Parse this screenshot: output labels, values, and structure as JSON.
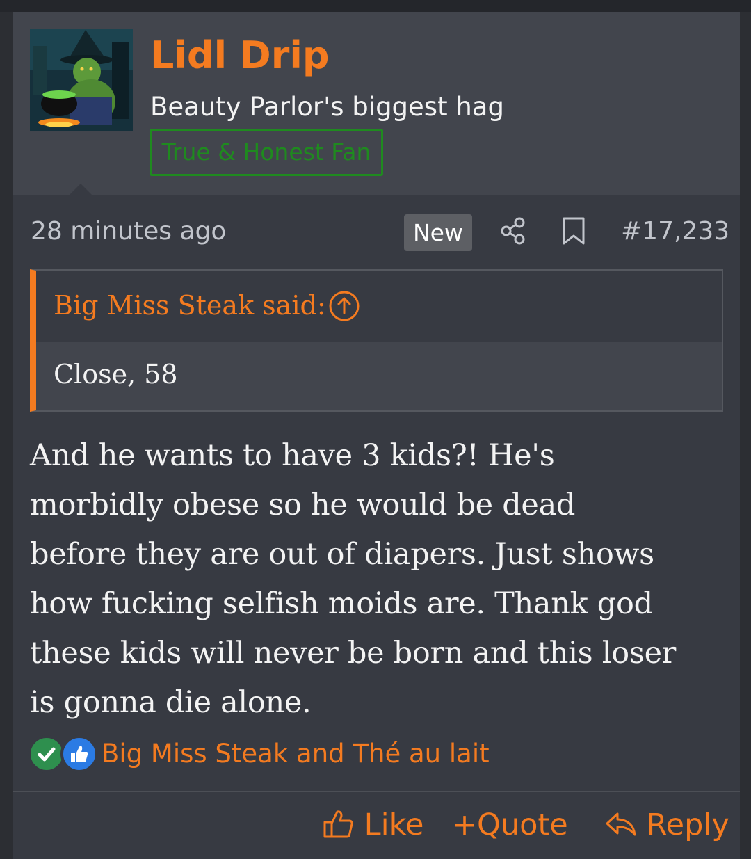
{
  "user": {
    "name": "Lidl Drip",
    "title": "Beauty Parlor's biggest hag",
    "banner": "True & Honest Fan",
    "avatar_icon": "witch-cauldron-avatar"
  },
  "meta": {
    "time": "28 minutes ago",
    "badge": "New",
    "post_number": "#17,233"
  },
  "quote": {
    "attribution": "Big Miss Steak said:",
    "text": "Close, 58"
  },
  "message": {
    "lines": [
      "And he wants to have 3 kids?! He's",
      "morbidly obese so he would be dead",
      "before they are out of diapers. Just shows",
      "how fucking selfish moids are. Thank god",
      "these kids will never be born and this loser",
      "is gonna die alone."
    ]
  },
  "reactions": {
    "names": "Big Miss Steak and Thé au lait",
    "icons": [
      "check-reaction-icon",
      "like-reaction-icon"
    ]
  },
  "actions": {
    "like": "Like",
    "quote": "+Quote",
    "reply": "Reply"
  },
  "colors": {
    "accent": "#f47b20",
    "banner": "#1f8a1f",
    "background": "#373a42"
  }
}
